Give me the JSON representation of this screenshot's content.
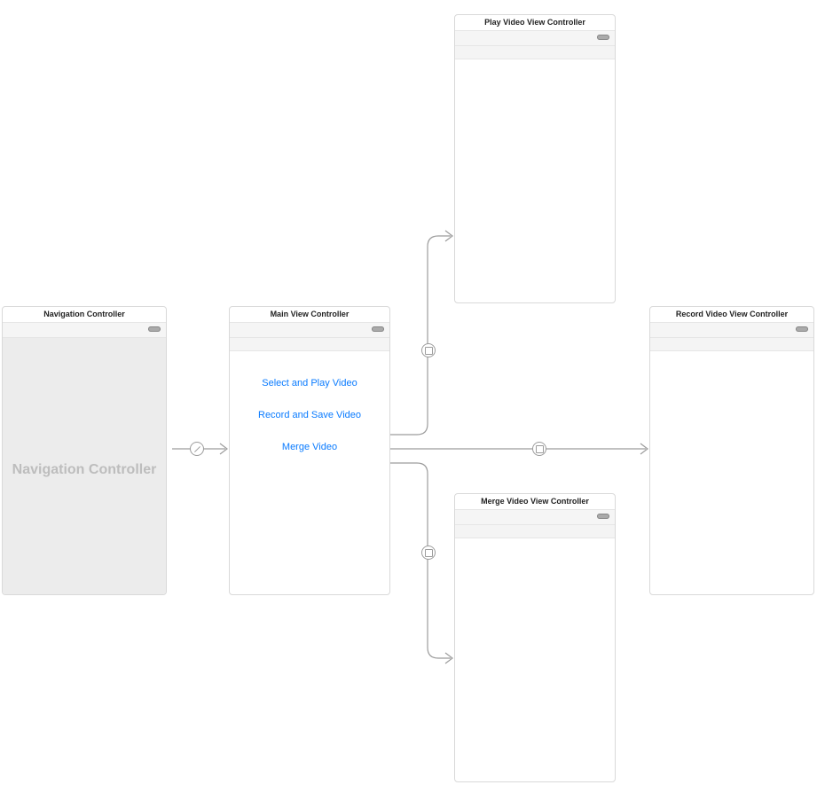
{
  "scenes": {
    "navigation": {
      "title": "Navigation Controller",
      "placeholder": "Navigation Controller"
    },
    "main": {
      "title": "Main View Controller",
      "buttons": {
        "play": "Select and Play Video",
        "record": "Record and Save Video",
        "merge": "Merge Video"
      }
    },
    "play": {
      "title": "Play Video View Controller"
    },
    "record": {
      "title": "Record Video View Controller"
    },
    "merge": {
      "title": "Merge Video View Controller"
    }
  }
}
